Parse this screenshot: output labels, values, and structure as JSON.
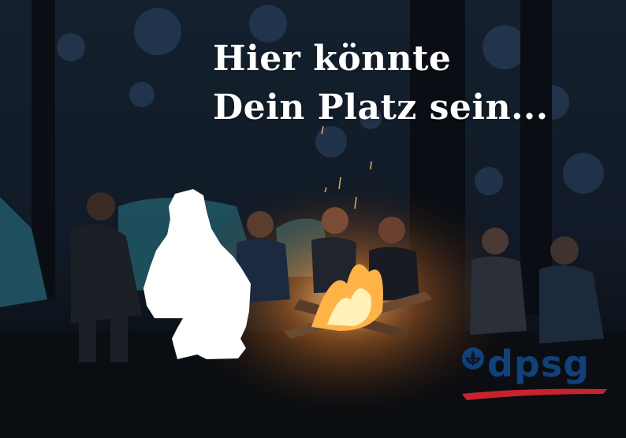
{
  "headline": {
    "line1": "Hier könnte",
    "line2": "Dein Platz sein..."
  },
  "logo": {
    "text": "dpsg",
    "icon": "lily-icon",
    "text_color": "#12407a",
    "swoosh_color": "#c8232c"
  },
  "colors": {
    "background": "#0e1622",
    "silhouette": "#ffffff",
    "fire": "#ffb347"
  }
}
